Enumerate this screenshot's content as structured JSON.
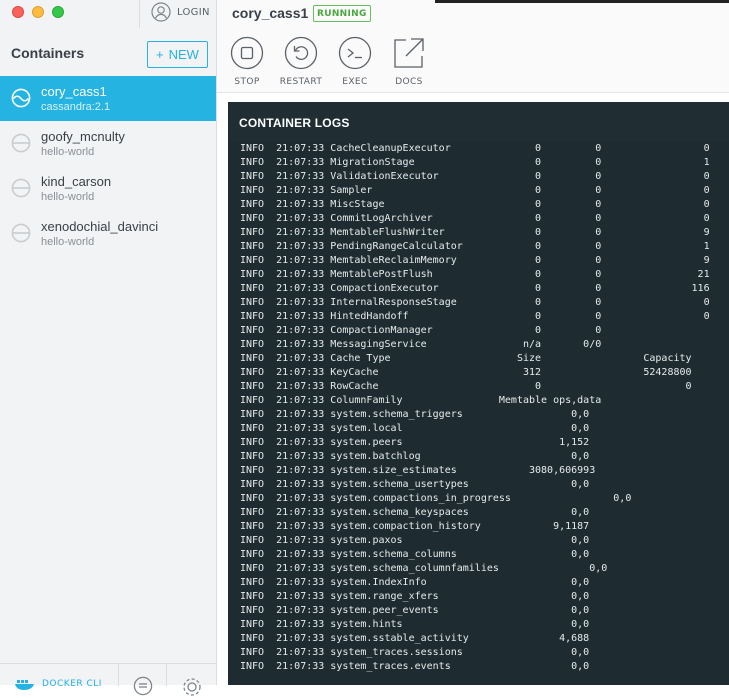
{
  "window": {
    "login_label": "LOGIN"
  },
  "sidebar": {
    "title": "Containers",
    "new_button": "NEW",
    "containers": [
      {
        "name": "cory_cass1",
        "image": "cassandra:2.1",
        "selected": true,
        "status": "running"
      },
      {
        "name": "goofy_mcnulty",
        "image": "hello-world",
        "selected": false,
        "status": "stopped"
      },
      {
        "name": "kind_carson",
        "image": "hello-world",
        "selected": false,
        "status": "stopped"
      },
      {
        "name": "xenodochial_davinci",
        "image": "hello-world",
        "selected": false,
        "status": "stopped"
      }
    ],
    "footer": {
      "docker_link_label": "DOCKER CLI",
      "chat_icon": "chat-icon",
      "settings_icon": "gear-icon"
    }
  },
  "header": {
    "container_name": "cory_cass1",
    "state_badge": "RUNNING",
    "actions": [
      {
        "label": "STOP",
        "icon": "stop-icon"
      },
      {
        "label": "RESTART",
        "icon": "restart-icon"
      },
      {
        "label": "EXEC",
        "icon": "terminal-icon"
      },
      {
        "label": "DOCS",
        "icon": "external-link-icon"
      }
    ]
  },
  "logs": {
    "title": "CONTAINER LOGS",
    "lines": [
      "INFO  21:07:33 CacheCleanupExecutor              0         0                 0",
      "INFO  21:07:33 MigrationStage                    0         0                 1",
      "INFO  21:07:33 ValidationExecutor                0         0                 0",
      "INFO  21:07:33 Sampler                           0         0                 0",
      "INFO  21:07:33 MiscStage                         0         0                 0",
      "INFO  21:07:33 CommitLogArchiver                 0         0                 0",
      "INFO  21:07:33 MemtableFlushWriter               0         0                 9",
      "INFO  21:07:33 PendingRangeCalculator            0         0                 1",
      "INFO  21:07:33 MemtableReclaimMemory             0         0                 9",
      "INFO  21:07:33 MemtablePostFlush                 0         0                21",
      "INFO  21:07:33 CompactionExecutor                0         0               116",
      "INFO  21:07:33 InternalResponseStage             0         0                 0",
      "INFO  21:07:33 HintedHandoff                     0         0                 0",
      "INFO  21:07:33 CompactionManager                 0         0",
      "INFO  21:07:33 MessagingService                n/a       0/0",
      "INFO  21:07:33 Cache Type                     Size                 Capacity",
      "INFO  21:07:33 KeyCache                        312                 52428800",
      "INFO  21:07:33 RowCache                          0                        0",
      "INFO  21:07:33 ColumnFamily                Memtable ops,data",
      "INFO  21:07:33 system.schema_triggers                  0,0",
      "INFO  21:07:33 system.local                            0,0",
      "INFO  21:07:33 system.peers                          1,152",
      "INFO  21:07:33 system.batchlog                         0,0",
      "INFO  21:07:33 system.size_estimates            3080,606993",
      "INFO  21:07:33 system.schema_usertypes                 0,0",
      "INFO  21:07:33 system.compactions_in_progress                 0,0",
      "INFO  21:07:33 system.schema_keyspaces                 0,0",
      "INFO  21:07:33 system.compaction_history            9,1187",
      "INFO  21:07:33 system.paxos                            0,0",
      "INFO  21:07:33 system.schema_columns                   0,0",
      "INFO  21:07:33 system.schema_columnfamilies               0,0",
      "INFO  21:07:33 system.IndexInfo                        0,0",
      "INFO  21:07:33 system.range_xfers                      0,0",
      "INFO  21:07:33 system.peer_events                      0,0",
      "INFO  21:07:33 system.hints                            0,0",
      "INFO  21:07:33 system.sstable_activity               4,688",
      "INFO  21:07:33 system_traces.sessions                  0,0",
      "INFO  21:07:33 system_traces.events                    0,0"
    ]
  },
  "colors": {
    "accent": "#25b3e1",
    "running": "#4aa83e",
    "log_background": "#1e2c31"
  }
}
